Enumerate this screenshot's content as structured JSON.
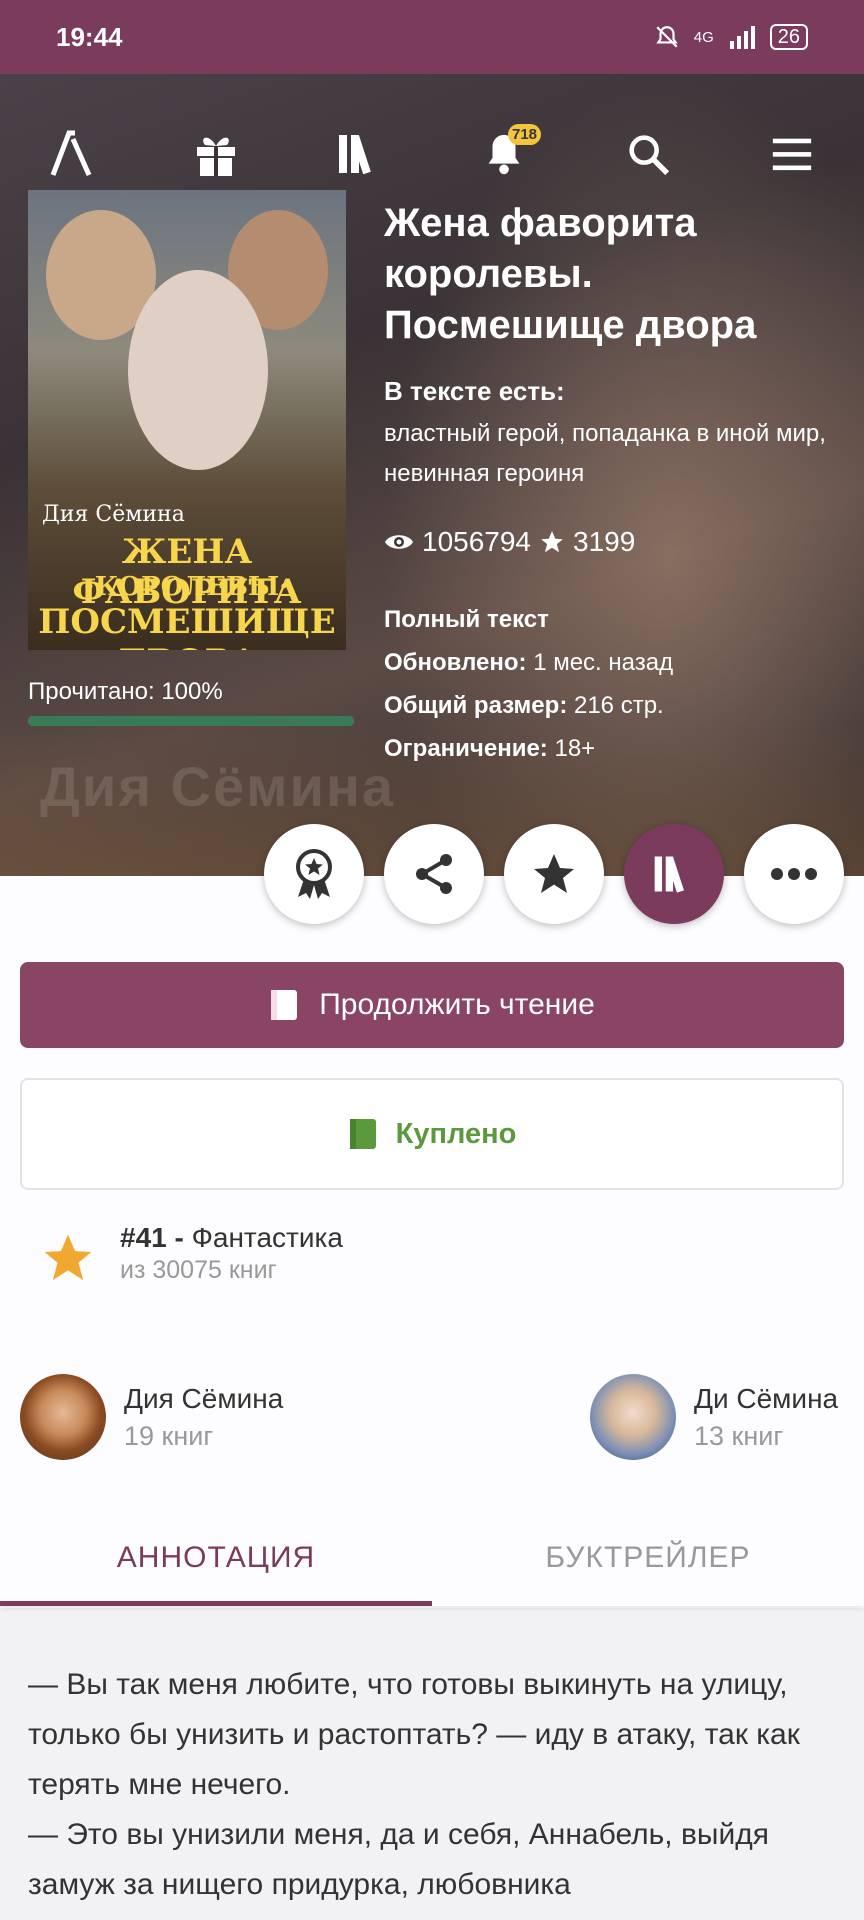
{
  "status_bar": {
    "time": "19:44",
    "network": "4G",
    "battery": "26"
  },
  "nav": {
    "notifications_count": "718"
  },
  "book": {
    "cover_author": "Дия Сёмина",
    "cover_title_1": "ЖЕНА ФАВОРИТА",
    "cover_title_2": "·КОРОЛЕВЫ·",
    "cover_title_3": "ПОСМЕШИЩЕ ДВОРА",
    "title": "Жена фаворита королевы. Посмешище двора",
    "tags_heading": "В тексте есть:",
    "tags": "властный герой, попаданка в иной мир, невинная героиня",
    "views": "1056794",
    "stars": "3199",
    "status": "Полный текст",
    "updated_label": "Обновлено:",
    "updated_value": "1 мес. назад",
    "size_label": "Общий размер:",
    "size_value": "216 стр.",
    "limit_label": "Ограничение:",
    "limit_value": "18+",
    "read_progress_label": "Прочитано: 100%",
    "read_progress": 1.0
  },
  "buttons": {
    "continue": "Продолжить чтение",
    "bought": "Куплено"
  },
  "rank": {
    "position": "#41 -",
    "genre": "Фантастика",
    "total": "из 30075 книг"
  },
  "authors": [
    {
      "name": "Дия Сёмина",
      "books": "19 книг"
    },
    {
      "name": "Ди Сёмина",
      "books": "13 книг"
    }
  ],
  "tabs": [
    "АННОТАЦИЯ",
    "БУКТРЕЙЛЕР"
  ],
  "annotation": [
    " — Вы так меня любите, что готовы выкинуть на улицу, только бы унизить и растоптать? — иду в атаку, так как терять мне нечего.",
    "— Это вы унизили меня, да и себя, Аннабель, выйдя замуж за нищего придурка, любовника"
  ],
  "colors": {
    "brand": "#7b3b5c",
    "accent_green": "#5a9a3c",
    "rank_star": "#f0a830"
  }
}
